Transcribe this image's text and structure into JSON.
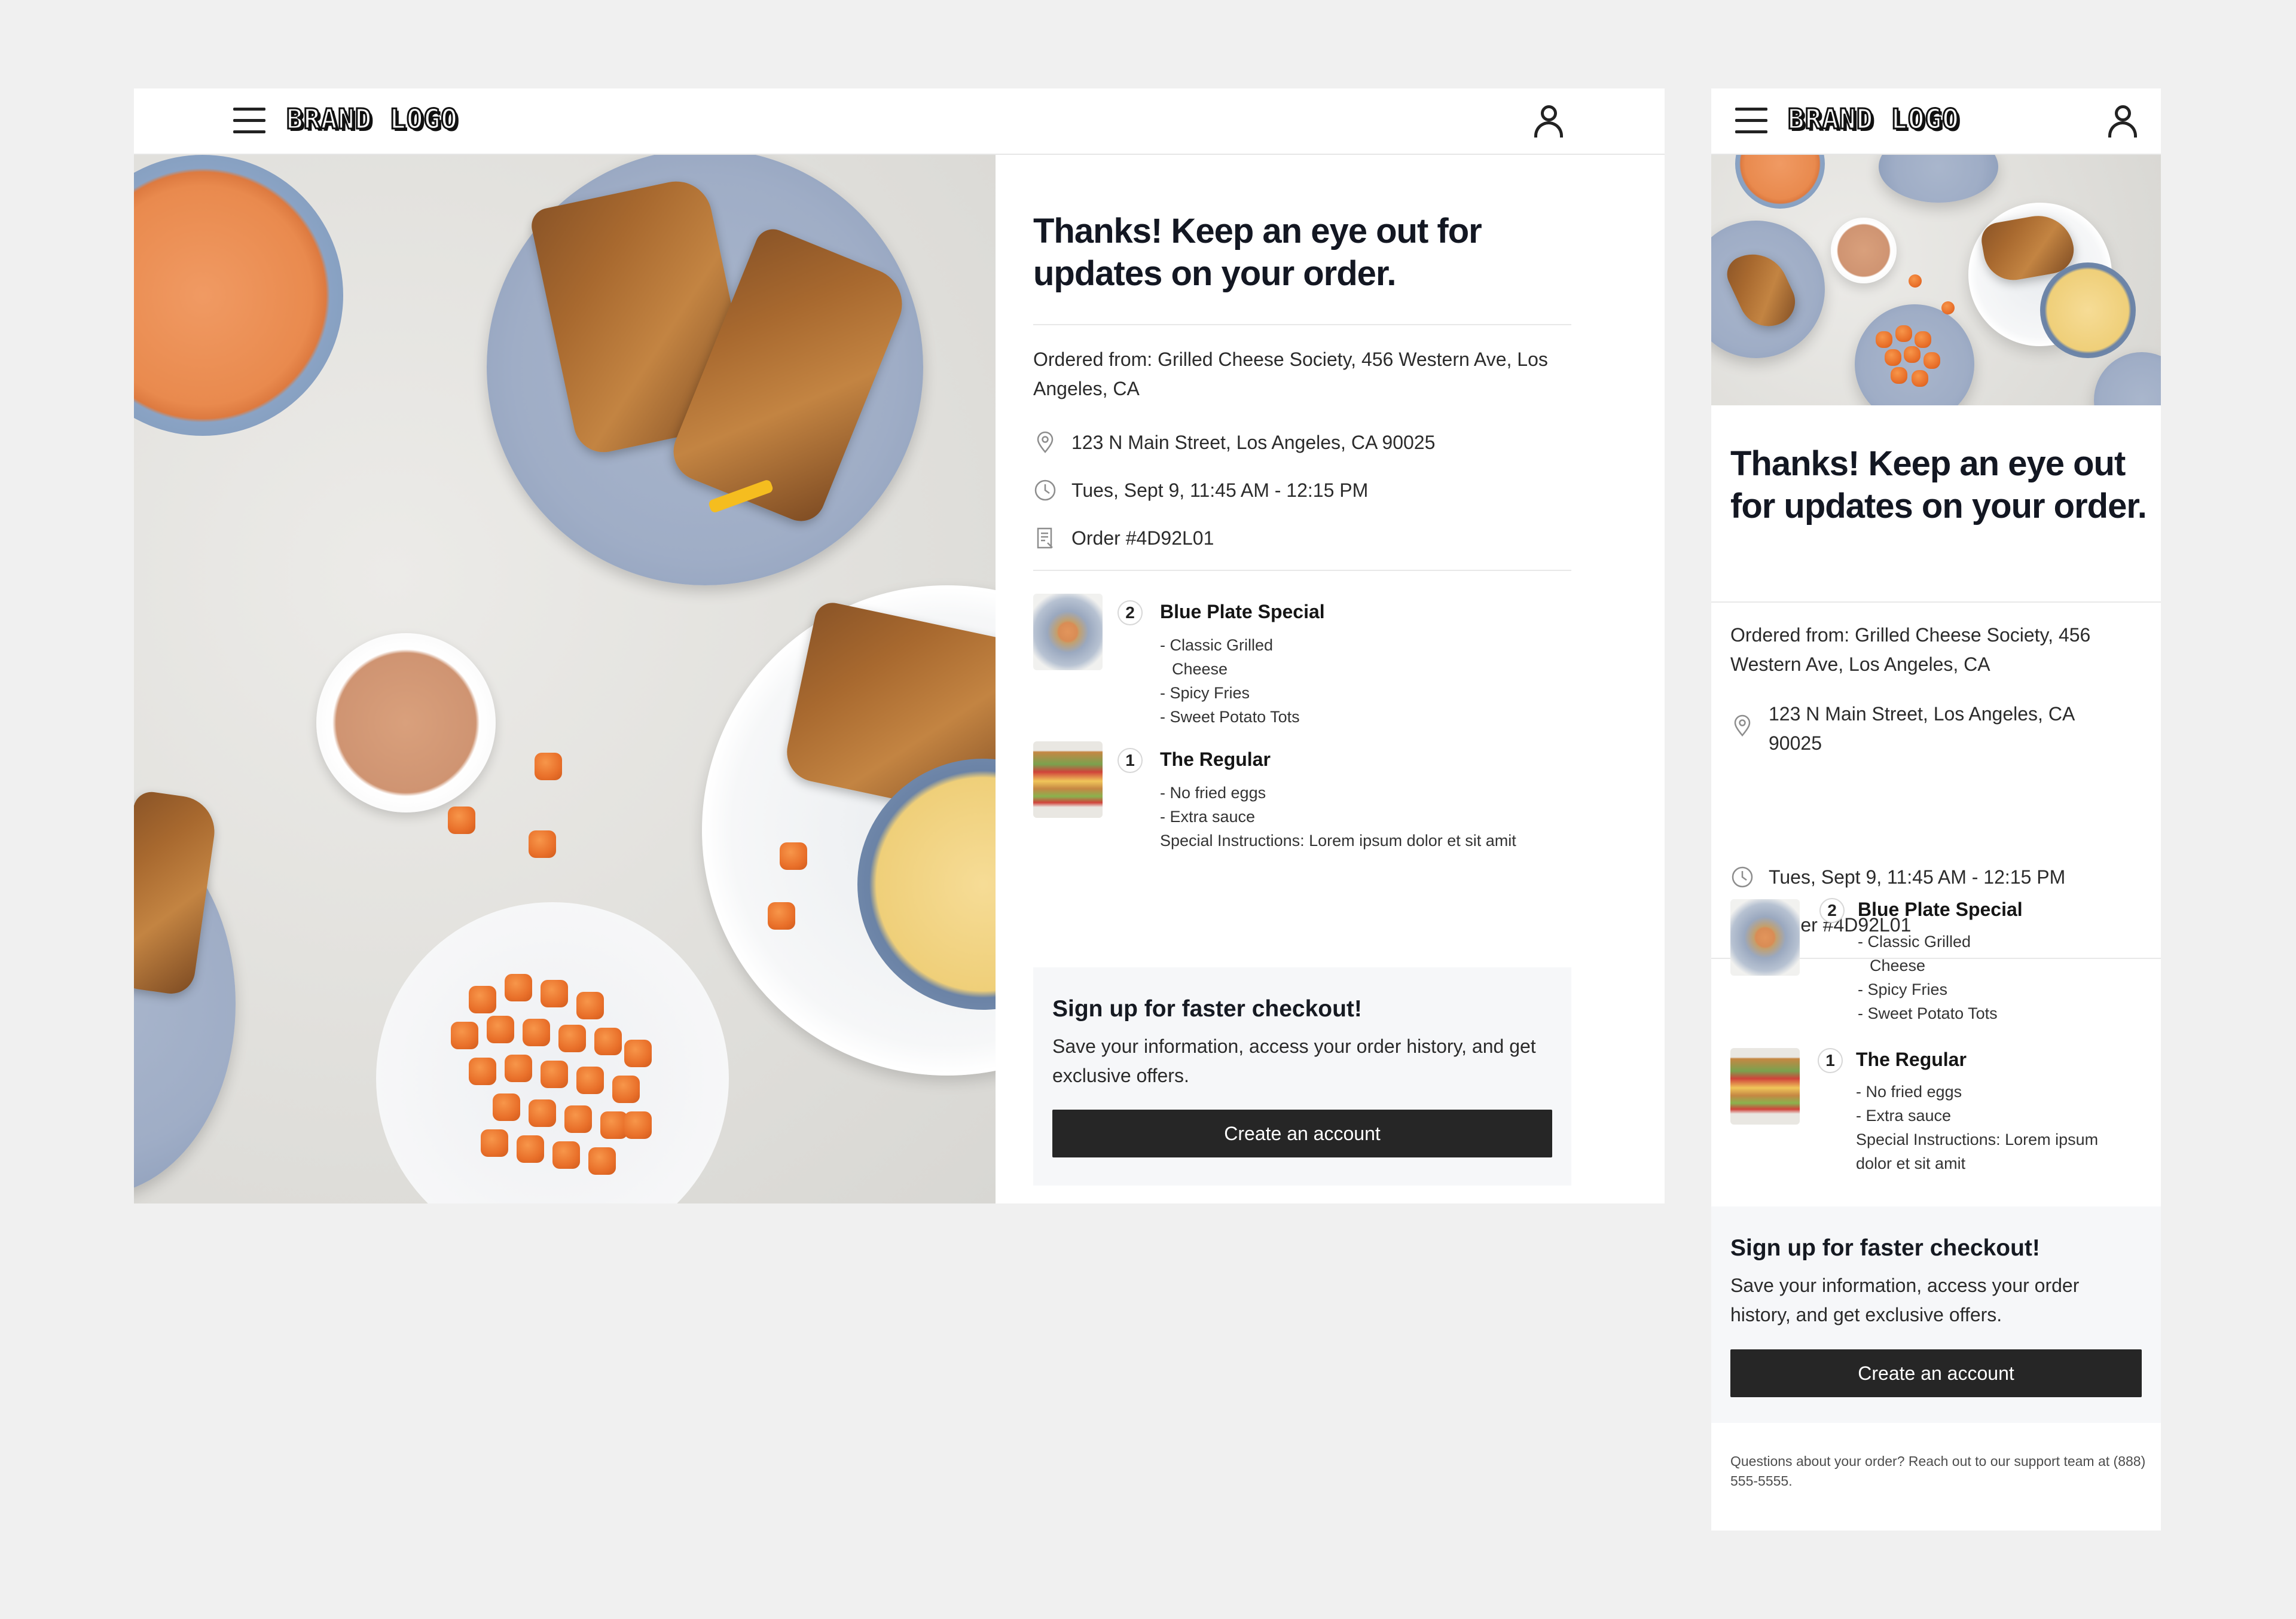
{
  "brand": {
    "logo_text": "BRAND LOGO"
  },
  "confirmation": {
    "heading": "Thanks! Keep an eye out for updates on your order.",
    "ordered_from": "Ordered from: Grilled Cheese Society, 456 Western Ave, Los Angeles, CA",
    "address": "123 N Main Street, Los Angeles, CA 90025",
    "time": "Tues, Sept 9, 11:45 AM - 12:15 PM",
    "order_number": "Order #4D92L01"
  },
  "items": [
    {
      "qty": "2",
      "name": "Blue Plate Special",
      "modifiers": [
        "- Classic Grilled",
        "Cheese",
        "- Spicy Fries",
        "- Sweet Potato Tots"
      ],
      "thumb_icon": "blue-plate-thumbnail"
    },
    {
      "qty": "1",
      "name": "The Regular",
      "modifiers": [
        "- No fried eggs",
        "- Extra sauce"
      ],
      "note_label": "Special Instructions:",
      "note": "Lorem ipsum dolor et sit amit",
      "note_full": "Special Instructions: Lorem ipsum dolor et sit amit",
      "thumb_icon": "sandwich-thumbnail"
    }
  ],
  "signup": {
    "title": "Sign up for faster checkout!",
    "description": "Save your information, access your order history, and get exclusive offers.",
    "button": "Create an account"
  },
  "support": {
    "text": "Questions about your order? Reach out to our support team at (888) 555-5555."
  },
  "icons": {
    "menu": "hamburger-menu-icon",
    "account": "user-icon",
    "address": "map-pin-icon",
    "time": "clock-icon",
    "order": "receipt-icon"
  },
  "colors": {
    "background": "#f0f0f0",
    "button": "#262626",
    "signup_panel": "#f6f7f9",
    "heading": "#131722"
  }
}
